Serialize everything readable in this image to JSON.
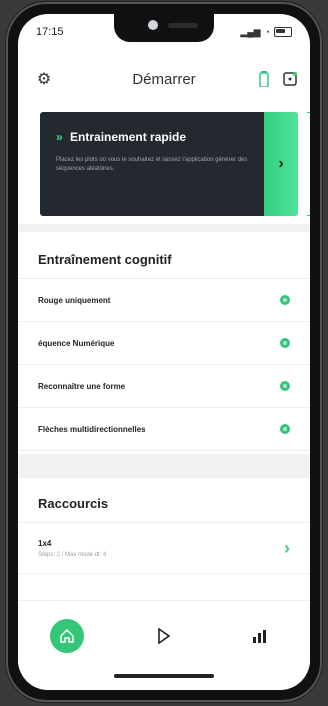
{
  "status": {
    "time": "17:15"
  },
  "header": {
    "title": "Démarrer",
    "icons": [
      "gear-icon",
      "battery-device-icon",
      "dice-icon"
    ]
  },
  "quick": {
    "title": "Entrainement rapide",
    "prefix": "»",
    "description": "Placez les plots où vous le souhaitez et laissez l'application générer des séquences aléatoires."
  },
  "cognitive": {
    "title": "Entraînement cognitif",
    "items": [
      {
        "label": "Rouge uniquement"
      },
      {
        "label": "équence Numérique"
      },
      {
        "label": "Reconnaître une forme"
      },
      {
        "label": "Flèches multidirectionnelles"
      }
    ]
  },
  "shortcuts": {
    "title": "Raccourcis",
    "items": [
      {
        "title": "1x4",
        "subtitle": "Steps: 2 / Max mode dt: 4"
      }
    ]
  },
  "nav": {
    "items": [
      "home-icon",
      "play-icon",
      "stats-icon"
    ]
  },
  "colors": {
    "accent": "#35c778",
    "dark_card": "#23292e"
  }
}
